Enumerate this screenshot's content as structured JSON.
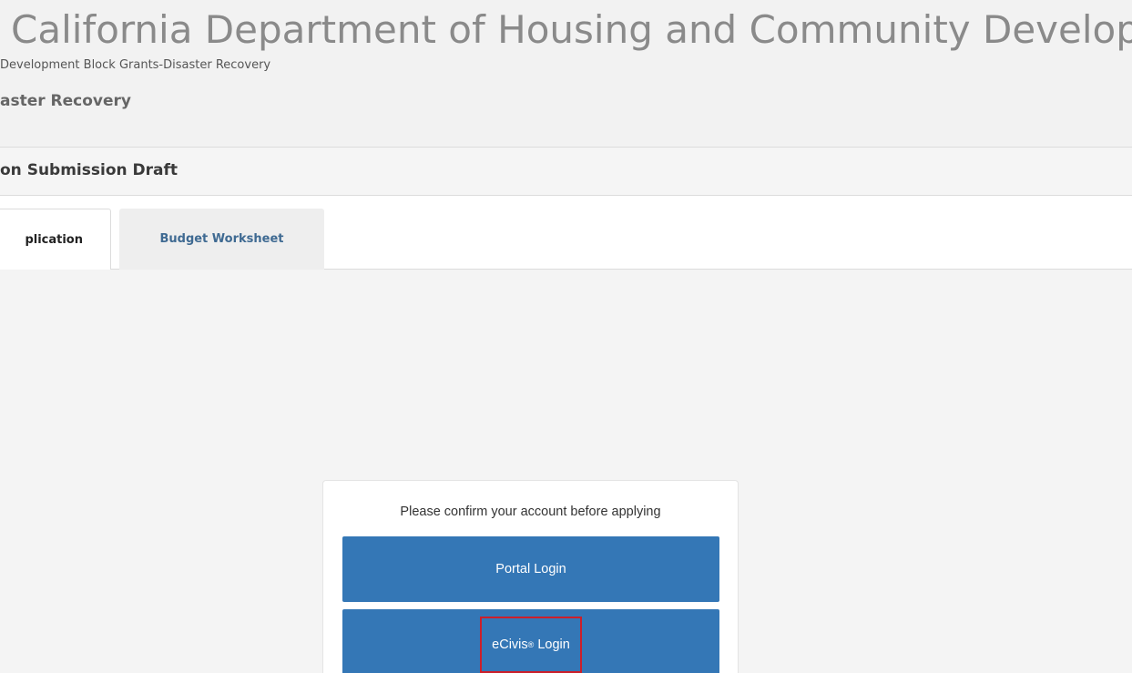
{
  "header": {
    "agency_title": "California Department of Housing and Community Development",
    "program_subtitle": "Development Block Grants-Disaster Recovery",
    "program_name": "aster Recovery"
  },
  "draft": {
    "title": "on Submission Draft"
  },
  "tabs": [
    {
      "label": "plication",
      "active": true
    },
    {
      "label": "Budget Worksheet",
      "active": false
    }
  ],
  "login_panel": {
    "prompt": "Please confirm your account before applying",
    "portal_login_label": "Portal Login",
    "ecivis_brand": "eCivis",
    "ecivis_mark": "®",
    "ecivis_suffix": "Login"
  },
  "colors": {
    "button_blue": "#3477b6",
    "tab_link": "#3f6a92",
    "highlight_box": "#cc1f2a"
  }
}
